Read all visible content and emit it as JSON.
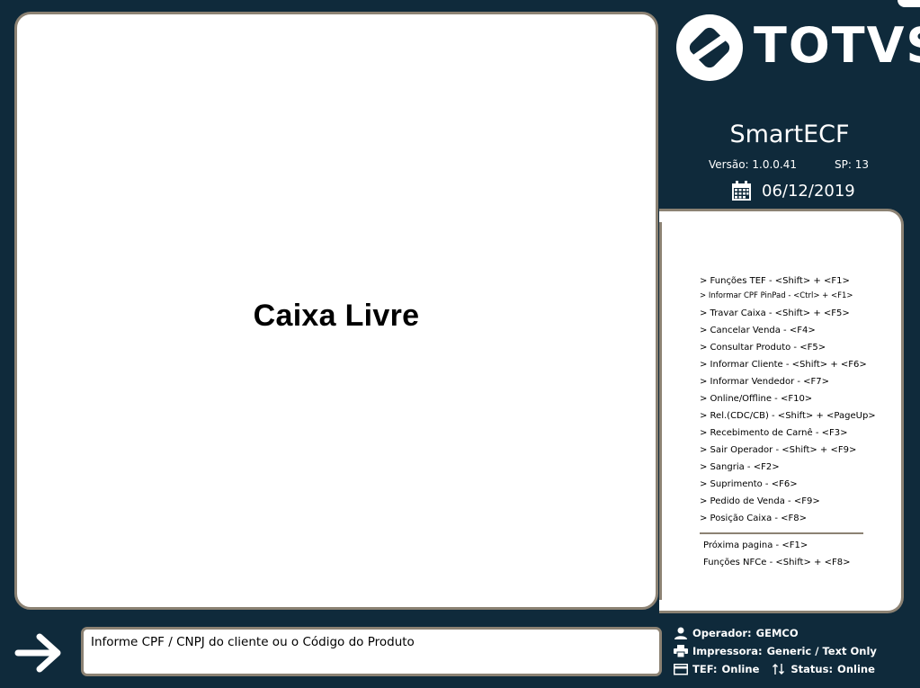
{
  "main": {
    "status_text": "Caixa Livre"
  },
  "brand": {
    "logo_text": "TOTVS",
    "app_name": "SmartECF",
    "version_label": "Versão: 1.0.0.41",
    "sp_label": "SP: 13",
    "date": "06/12/2019",
    "calendar_icon": "calendar-icon"
  },
  "shortcuts": {
    "items": [
      {
        "label": "> Funções TEF - <Shift> + <F1>",
        "small": false
      },
      {
        "label": "> Informar CPF PinPad - <Ctrl> + <F1>",
        "small": true
      },
      {
        "label": "> Travar Caixa - <Shift> + <F5>",
        "small": false
      },
      {
        "label": "> Cancelar Venda - <F4>",
        "small": false
      },
      {
        "label": "> Consultar Produto - <F5>",
        "small": false
      },
      {
        "label": "> Informar Cliente - <Shift> + <F6>",
        "small": false
      },
      {
        "label": "> Informar Vendedor - <F7>",
        "small": false
      },
      {
        "label": "> Online/Offline - <F10>",
        "small": false
      },
      {
        "label": "> Rel.(CDC/CB) - <Shift> + <PageUp>",
        "small": false
      },
      {
        "label": "> Recebimento de Carnê - <F3>",
        "small": false
      },
      {
        "label": "> Sair Operador - <Shift> + <F9>",
        "small": false
      },
      {
        "label": "> Sangria - <F2>",
        "small": false
      },
      {
        "label": "> Suprimento - <F6>",
        "small": false
      },
      {
        "label": "> Pedido de Venda - <F9>",
        "small": false
      },
      {
        "label": "> Posição Caixa - <F8>",
        "small": false
      }
    ],
    "footer_items": [
      {
        "label": "Próxima pagina - <F1>"
      },
      {
        "label": "Funções NFCe - <Shift> + <F8>"
      }
    ]
  },
  "input": {
    "placeholder": "Informe CPF / CNPJ do cliente ou o Código do Produto",
    "value": ""
  },
  "status": {
    "operador_label": "Operador:",
    "operador_value": "GEMCO",
    "impressora_label": "Impressora:",
    "impressora_value": "Generic / Text Only",
    "tef_label": "TEF:",
    "tef_value": "Online",
    "status_label": "Status:",
    "status_value": "Online"
  },
  "colors": {
    "background": "#0f2a3b",
    "panel_border": "#8c8273",
    "panel_fill": "#ffffff"
  }
}
